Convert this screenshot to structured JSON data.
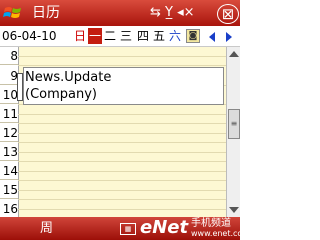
{
  "titlebar": {
    "app_title": "日历",
    "status_icons": "⇆ Y̲ ◂×",
    "ok_label": "⊠"
  },
  "datebar": {
    "date": "06-04-10",
    "weekdays": [
      "日",
      "一",
      "二",
      "三",
      "四",
      "五",
      "六"
    ],
    "selected_weekday": "一",
    "today_icon": "◙"
  },
  "hours": [
    "8",
    "9",
    "10",
    "11",
    "12",
    "13",
    "14",
    "15",
    "16"
  ],
  "appointment": {
    "title": "News.Update",
    "location": "(Company)"
  },
  "scrollbar": {
    "thumb_glyph": "≡"
  },
  "softbar": {
    "left": "周",
    "keyboard_icon": "▦",
    "watermark": "eNet",
    "watermark_sub1": "手机频道",
    "watermark_sub2": "www.enet.com.cn"
  }
}
